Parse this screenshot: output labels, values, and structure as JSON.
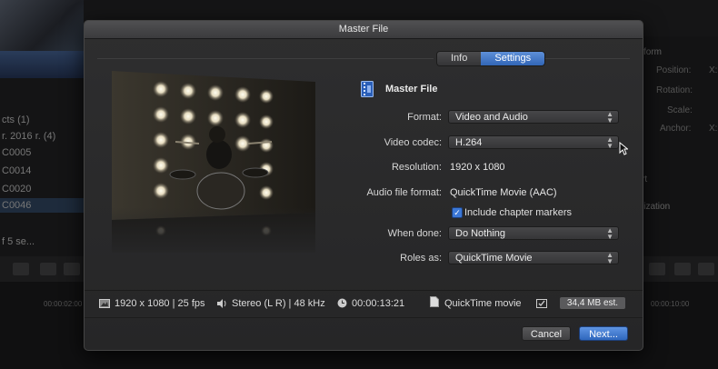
{
  "background": {
    "library_items": [
      "cts (1)",
      "r. 2016 r. (4)",
      "C0005",
      "C0014",
      "C0020",
      "C0046",
      "f 5 se..."
    ],
    "inspector_header": "form",
    "inspector_fields": [
      "Position:",
      "Rotation:",
      "Scale:",
      "Anchor:"
    ],
    "inspector_x": "X:",
    "inspector_sections": [
      "rt",
      "lization"
    ],
    "timecodes": [
      "00:00:02:00",
      "00:00:10:00"
    ]
  },
  "dialog": {
    "title": "Master File",
    "tabs": [
      {
        "label": "Info",
        "active": false
      },
      {
        "label": "Settings",
        "active": true
      }
    ],
    "file_title": "Master File",
    "fields": {
      "format": {
        "label": "Format:",
        "value": "Video and Audio"
      },
      "video_codec": {
        "label": "Video codec:",
        "value": "H.264"
      },
      "resolution": {
        "label": "Resolution:",
        "value": "1920 x 1080"
      },
      "audio_format": {
        "label": "Audio file format:",
        "value": "QuickTime Movie (AAC)"
      },
      "chapter_markers": {
        "label": "Include chapter markers",
        "checked": true
      },
      "when_done": {
        "label": "When done:",
        "value": "Do Nothing"
      },
      "roles_as": {
        "label": "Roles as:",
        "value": "QuickTime Movie"
      }
    },
    "info_bar": {
      "video": "1920 x 1080 | 25 fps",
      "audio": "Stereo (L R) | 48 kHz",
      "duration": "00:00:13:21",
      "file_type": "QuickTime movie",
      "size": "34,4 MB est."
    },
    "buttons": {
      "cancel": "Cancel",
      "next": "Next..."
    }
  },
  "colors": {
    "accent": "#3a6fc4",
    "dialog_bg": "#2a2a2b"
  }
}
